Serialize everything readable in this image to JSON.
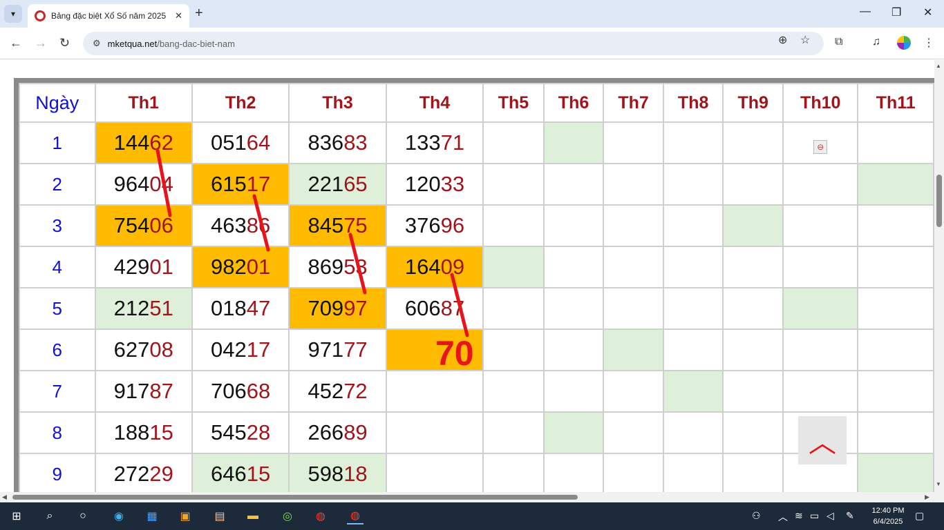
{
  "browser": {
    "tab_title": "Bảng đặc biệt Xổ Số năm 2025",
    "url_host": "mketqua.net",
    "url_path": "/bang-dac-biet-nam"
  },
  "table": {
    "day_header": "Ngày",
    "months": [
      "Th1",
      "Th2",
      "Th3",
      "Th4",
      "Th5",
      "Th6",
      "Th7",
      "Th8",
      "Th9",
      "Th10",
      "Th11"
    ],
    "rows": [
      {
        "day": "1",
        "cells": [
          "14462",
          "05164",
          "83683",
          "13371",
          "",
          "",
          "",
          "",
          "",
          "",
          ""
        ]
      },
      {
        "day": "2",
        "cells": [
          "96404",
          "61517",
          "22165",
          "12033",
          "",
          "",
          "",
          "",
          "",
          "",
          ""
        ]
      },
      {
        "day": "3",
        "cells": [
          "75406",
          "46386",
          "84575",
          "37696",
          "",
          "",
          "",
          "",
          "",
          "",
          ""
        ]
      },
      {
        "day": "4",
        "cells": [
          "42901",
          "98201",
          "86953",
          "16409",
          "",
          "",
          "",
          "",
          "",
          "",
          ""
        ]
      },
      {
        "day": "5",
        "cells": [
          "21251",
          "01847",
          "70997",
          "60687",
          "",
          "",
          "",
          "",
          "",
          "",
          ""
        ]
      },
      {
        "day": "6",
        "cells": [
          "62708",
          "04217",
          "97177",
          "",
          "",
          "",
          "",
          "",
          "",
          "",
          ""
        ]
      },
      {
        "day": "7",
        "cells": [
          "91787",
          "70668",
          "45272",
          "",
          "",
          "",
          "",
          "",
          "",
          "",
          ""
        ]
      },
      {
        "day": "8",
        "cells": [
          "18815",
          "54528",
          "26689",
          "",
          "",
          "",
          "",
          "",
          "",
          "",
          ""
        ]
      },
      {
        "day": "9",
        "cells": [
          "27229",
          "64615",
          "59818",
          "",
          "",
          "",
          "",
          "",
          "",
          "",
          ""
        ]
      }
    ],
    "highlight_color": "#ffbb00",
    "green_color": "#dff0da",
    "tail_color": "#a0141c"
  },
  "annotation": {
    "big_number": "70",
    "line_color": "#e8141c"
  },
  "taskbar": {
    "time": "12:40 PM",
    "date": "6/4/2025"
  }
}
